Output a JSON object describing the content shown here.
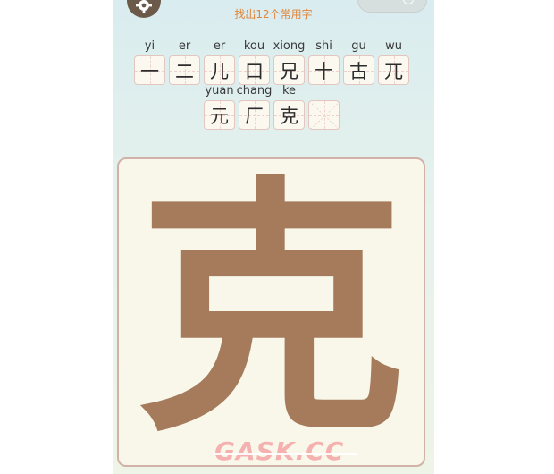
{
  "header": {
    "hint": "找出12个常用字"
  },
  "found": [
    {
      "pinyin": "yi",
      "char": "一"
    },
    {
      "pinyin": "er",
      "char": "二"
    },
    {
      "pinyin": "er",
      "char": "儿"
    },
    {
      "pinyin": "kou",
      "char": "口"
    },
    {
      "pinyin": "xiong",
      "char": "兄"
    },
    {
      "pinyin": "shi",
      "char": "十"
    },
    {
      "pinyin": "gu",
      "char": "古"
    },
    {
      "pinyin": "wu",
      "char": "兀"
    },
    {
      "pinyin": "yuan",
      "char": "元"
    },
    {
      "pinyin": "chang",
      "char": "厂"
    },
    {
      "pinyin": "ke",
      "char": "克"
    },
    {
      "pinyin": "",
      "char": ""
    }
  ],
  "board": {
    "character": "克"
  },
  "watermark": "GASK.CC",
  "colors": {
    "hint": "#e0853a",
    "stroke": "#a57b5c",
    "board_border": "#d2b2a8"
  }
}
